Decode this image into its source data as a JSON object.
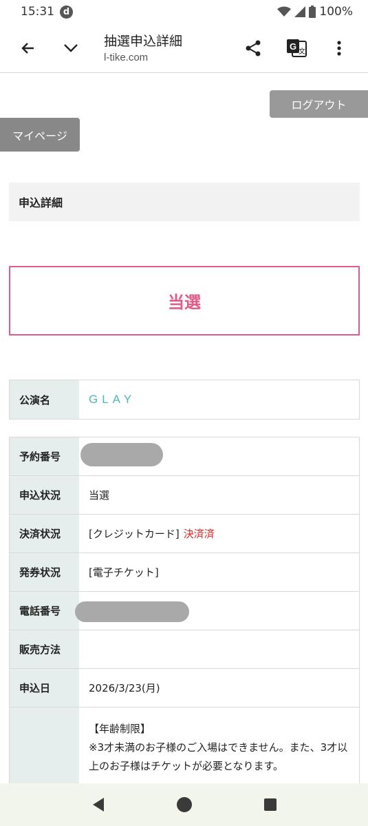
{
  "status": {
    "time": "15:31",
    "carrier_icon": "d",
    "battery": "100%"
  },
  "browser": {
    "title": "抽選申込詳細",
    "url": "l-tike.com"
  },
  "page": {
    "logout_label": "ログアウト",
    "mypage_label": "マイページ",
    "section_title": "申込詳細",
    "result": "当選"
  },
  "performance": {
    "label": "公演名",
    "value": "GLAY"
  },
  "details": {
    "reservation_label": "予約番号",
    "status_label": "申込状況",
    "status_value": "当選",
    "payment_label": "決済状況",
    "payment_method": "[クレジットカード]",
    "payment_status": "決済済",
    "ticketing_label": "発券状況",
    "ticketing_value": "[電子チケット]",
    "phone_label": "電話番号",
    "sales_label": "販売方法",
    "sales_value": "",
    "date_label": "申込日",
    "date_value": "2026/3/23(月)",
    "notes_title": "【年齢制限】",
    "notes_body": "※3才未満のお子様のご入場はできません。また、3才以上のお子様はチケットが必要となります。"
  },
  "colors": {
    "accent": "#e25b86",
    "teal": "#4fb7b7",
    "paid": "#e02020"
  }
}
